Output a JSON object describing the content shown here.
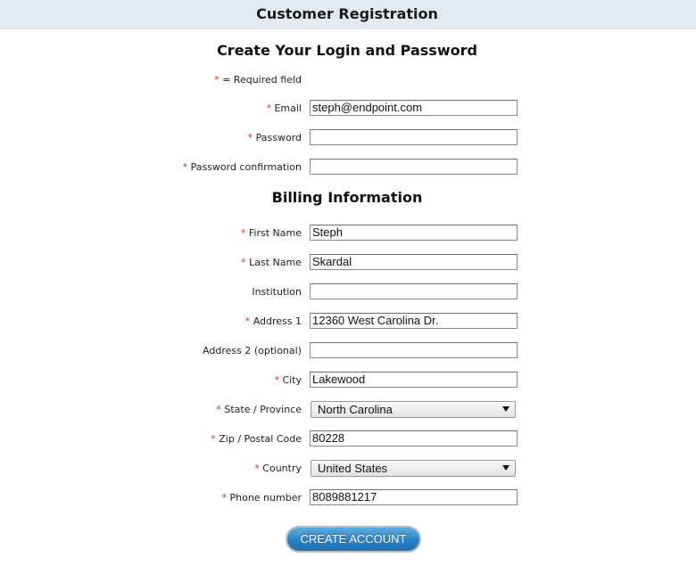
{
  "header": {
    "title": "Customer Registration"
  },
  "login_section": {
    "title": "Create Your Login and Password",
    "required_note": "= Required field",
    "required_mark": "*",
    "fields": {
      "email": {
        "label": "Email",
        "value": "steph@endpoint.com",
        "required": true
      },
      "password": {
        "label": "Password",
        "value": "",
        "required": true
      },
      "password_confirmation": {
        "label": "Password confirmation",
        "value": "",
        "required": true
      }
    }
  },
  "billing_section": {
    "title": "Billing Information",
    "fields": {
      "first_name": {
        "label": "First Name",
        "value": "Steph",
        "required": true
      },
      "last_name": {
        "label": "Last Name",
        "value": "Skardal",
        "required": true
      },
      "institution": {
        "label": "Institution",
        "value": "",
        "required": false
      },
      "address1": {
        "label": "Address 1",
        "value": "12360 West Carolina Dr.",
        "required": true
      },
      "address2": {
        "label": "Address 2 (optional)",
        "value": "",
        "required": false
      },
      "city": {
        "label": "City",
        "value": "Lakewood",
        "required": true
      },
      "state": {
        "label": "State / Province",
        "selected": "North Carolina",
        "required": true
      },
      "zip": {
        "label": "Zip / Postal Code",
        "value": "80228",
        "required": true
      },
      "country": {
        "label": "Country",
        "selected": "United States",
        "required": true
      },
      "phone": {
        "label": "Phone number",
        "value": "8089881217",
        "required": true
      }
    }
  },
  "actions": {
    "submit_label": "CREATE ACCOUNT"
  },
  "colors": {
    "required_star": "#d3322c",
    "header_bg": "#e3eaf4",
    "button": "#2d84c6"
  }
}
